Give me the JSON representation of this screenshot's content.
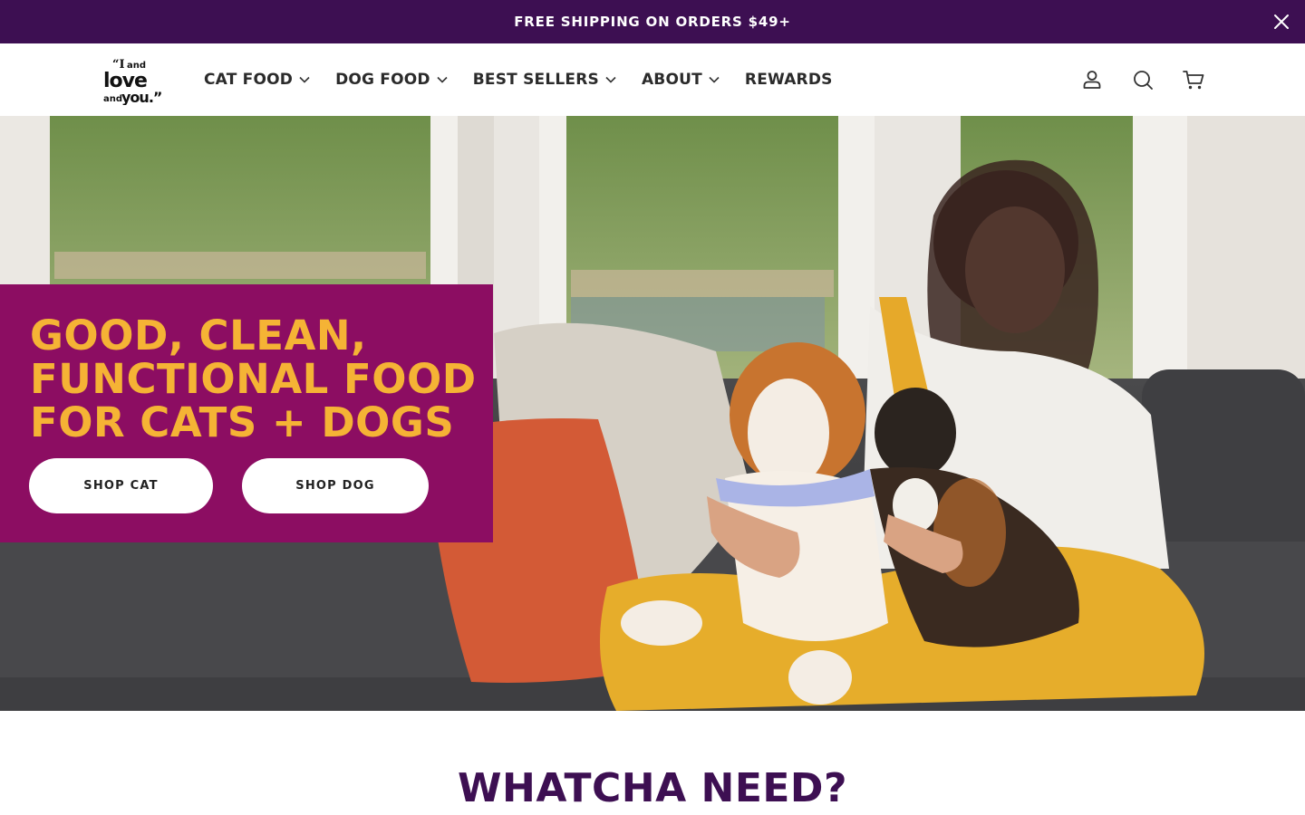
{
  "announcement": {
    "text": "FREE SHIPPING ON ORDERS $49+",
    "close_icon": "close-icon"
  },
  "header": {
    "logo_alt": "I and love and you",
    "nav": [
      {
        "label": "CAT FOOD",
        "has_dropdown": true
      },
      {
        "label": "DOG FOOD",
        "has_dropdown": true
      },
      {
        "label": "BEST SELLERS",
        "has_dropdown": true
      },
      {
        "label": "ABOUT",
        "has_dropdown": true
      },
      {
        "label": "REWARDS",
        "has_dropdown": false
      }
    ],
    "icons": [
      "account-icon",
      "search-icon",
      "cart-icon"
    ]
  },
  "hero": {
    "title_lines": [
      "GOOD, CLEAN,",
      "FUNCTIONAL FOOD",
      "FOR CATS + DOGS"
    ],
    "buttons": {
      "cat": "SHOP CAT",
      "dog": "SHOP DOG"
    }
  },
  "section": {
    "heading": "WHATCHA NEED?"
  },
  "colors": {
    "announcement_bg": "#3d0f52",
    "hero_panel": "#8c0d62",
    "hero_title": "#f5b335",
    "heading": "#3d0f52"
  }
}
